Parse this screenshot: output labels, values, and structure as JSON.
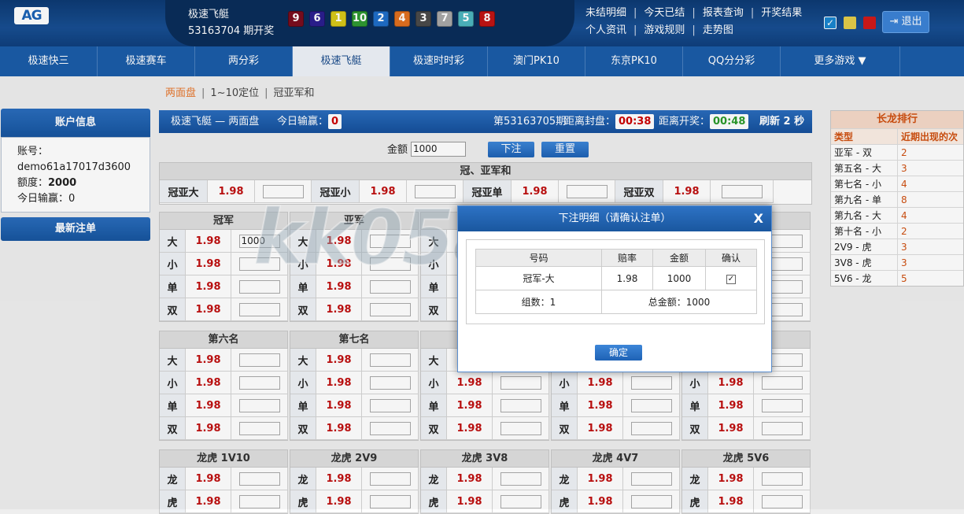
{
  "header": {
    "logo": "AG",
    "game_name": "极速飞艇",
    "period_open": "53163704 期开奖",
    "balls": [
      {
        "n": "9",
        "color": "#7a0d1f"
      },
      {
        "n": "6",
        "color": "#2b1f8f"
      },
      {
        "n": "1",
        "color": "#d8c81a"
      },
      {
        "n": "10",
        "color": "#2f9a32"
      },
      {
        "n": "2",
        "color": "#1f6ec8"
      },
      {
        "n": "4",
        "color": "#e07020"
      },
      {
        "n": "3",
        "color": "#4a4a4a"
      },
      {
        "n": "7",
        "color": "#a8a8a8"
      },
      {
        "n": "5",
        "color": "#4cb6bf"
      },
      {
        "n": "8",
        "color": "#c01414"
      }
    ],
    "links_row1": [
      "未结明细",
      "今天已结",
      "报表查询",
      "开奖结果"
    ],
    "links_row2": [
      "个人资讯",
      "游戏规则",
      "走势图"
    ],
    "logout": "退出"
  },
  "nav": [
    "极速快三",
    "极速赛车",
    "两分彩",
    "极速飞艇",
    "极速时时彩",
    "澳门PK10",
    "东京PK10",
    "QQ分分彩",
    "更多游戏 ▼"
  ],
  "subnav": {
    "items": [
      "两面盘",
      "1~10定位",
      "冠亚军和"
    ],
    "active": "两面盘"
  },
  "account": {
    "title": "账户信息",
    "acct_label": "账号：",
    "acct_value": "demo61a17017d3600",
    "quota_label": "额度：",
    "quota_value": "2000",
    "today_label": "今日输赢：",
    "today_value": "0",
    "latest_orders": "最新注单"
  },
  "infobar": {
    "title": "极速飞艇 — 两面盘",
    "today_label": "今日输赢：",
    "today_value": "0",
    "period": "第53163705期",
    "close_label": "距离封盘：",
    "close_value": "00:38",
    "open_label": "距离开奖：",
    "open_value": "00:48",
    "refresh": "刷新 2 秒"
  },
  "betbar": {
    "amount_label": "金额",
    "amount_value": "1000",
    "submit": "下注",
    "reset": "重置"
  },
  "gyh": {
    "title": "冠、亚军和",
    "items": [
      {
        "label": "冠亚大",
        "odds": "1.98"
      },
      {
        "label": "冠亚小",
        "odds": "1.98"
      },
      {
        "label": "冠亚单",
        "odds": "1.98"
      },
      {
        "label": "冠亚双",
        "odds": "1.98"
      }
    ]
  },
  "sections_row1": [
    {
      "title": "冠军",
      "rows": [
        {
          "label": "大",
          "odds": "1.98",
          "value": "1000"
        },
        {
          "label": "小",
          "odds": "1.98",
          "value": ""
        },
        {
          "label": "单",
          "odds": "1.98",
          "value": ""
        },
        {
          "label": "双",
          "odds": "1.98",
          "value": ""
        }
      ]
    },
    {
      "title": "亚军",
      "rows": [
        {
          "label": "大",
          "odds": "1.98",
          "value": ""
        },
        {
          "label": "小",
          "odds": "1.98",
          "value": ""
        },
        {
          "label": "单",
          "odds": "1.98",
          "value": ""
        },
        {
          "label": "双",
          "odds": "1.98",
          "value": ""
        }
      ]
    },
    {
      "title": "",
      "rows": [
        {
          "label": "大",
          "odds": "",
          "value": ""
        },
        {
          "label": "小",
          "odds": "",
          "value": ""
        },
        {
          "label": "单",
          "odds": "",
          "value": ""
        },
        {
          "label": "双",
          "odds": "",
          "value": ""
        }
      ]
    },
    {
      "title": "",
      "rows": [
        {
          "label": "",
          "odds": "",
          "value": ""
        },
        {
          "label": "",
          "odds": "",
          "value": ""
        },
        {
          "label": "",
          "odds": "",
          "value": ""
        },
        {
          "label": "",
          "odds": "",
          "value": ""
        }
      ]
    },
    {
      "title": "",
      "rows": [
        {
          "label": "",
          "odds": "",
          "value": ""
        },
        {
          "label": "",
          "odds": "",
          "value": ""
        },
        {
          "label": "",
          "odds": "",
          "value": ""
        },
        {
          "label": "",
          "odds": "",
          "value": ""
        }
      ]
    }
  ],
  "sections_row2": [
    {
      "title": "第六名",
      "rows": [
        {
          "label": "大",
          "odds": "1.98"
        },
        {
          "label": "小",
          "odds": "1.98"
        },
        {
          "label": "单",
          "odds": "1.98"
        },
        {
          "label": "双",
          "odds": "1.98"
        }
      ]
    },
    {
      "title": "第七名",
      "rows": [
        {
          "label": "大",
          "odds": "1.98"
        },
        {
          "label": "小",
          "odds": "1.98"
        },
        {
          "label": "单",
          "odds": "1.98"
        },
        {
          "label": "双",
          "odds": "1.98"
        }
      ]
    },
    {
      "title": "",
      "rows": [
        {
          "label": "大",
          "odds": ""
        },
        {
          "label": "小",
          "odds": "1.98"
        },
        {
          "label": "单",
          "odds": "1.98"
        },
        {
          "label": "双",
          "odds": "1.98"
        }
      ]
    },
    {
      "title": "",
      "rows": [
        {
          "label": "",
          "odds": ""
        },
        {
          "label": "小",
          "odds": "1.98"
        },
        {
          "label": "单",
          "odds": "1.98"
        },
        {
          "label": "双",
          "odds": "1.98"
        }
      ]
    },
    {
      "title": "",
      "rows": [
        {
          "label": "",
          "odds": ""
        },
        {
          "label": "小",
          "odds": "1.98"
        },
        {
          "label": "单",
          "odds": "1.98"
        },
        {
          "label": "双",
          "odds": "1.98"
        }
      ]
    }
  ],
  "sections_row3": [
    {
      "title": "龙虎 1V10",
      "rows": [
        {
          "label": "龙",
          "odds": "1.98"
        },
        {
          "label": "虎",
          "odds": "1.98"
        }
      ]
    },
    {
      "title": "龙虎 2V9",
      "rows": [
        {
          "label": "龙",
          "odds": "1.98"
        },
        {
          "label": "虎",
          "odds": "1.98"
        }
      ]
    },
    {
      "title": "龙虎 3V8",
      "rows": [
        {
          "label": "龙",
          "odds": "1.98"
        },
        {
          "label": "虎",
          "odds": "1.98"
        }
      ]
    },
    {
      "title": "龙虎 4V7",
      "rows": [
        {
          "label": "龙",
          "odds": "1.98"
        },
        {
          "label": "虎",
          "odds": "1.98"
        }
      ]
    },
    {
      "title": "龙虎 5V6",
      "rows": [
        {
          "label": "龙",
          "odds": "1.98"
        },
        {
          "label": "虎",
          "odds": "1.98"
        }
      ]
    }
  ],
  "ranking": {
    "title": "长龙排行",
    "col_type": "类型",
    "col_recent": "近期出现的次",
    "rows": [
      {
        "type": "亚军 - 双",
        "count": "2"
      },
      {
        "type": "第五名 - 大",
        "count": "3"
      },
      {
        "type": "第七名 - 小",
        "count": "4"
      },
      {
        "type": "第九名 - 单",
        "count": "8"
      },
      {
        "type": "第九名 - 大",
        "count": "4"
      },
      {
        "type": "第十名 - 小",
        "count": "2"
      },
      {
        "type": "2V9 - 虎",
        "count": "3"
      },
      {
        "type": "3V8 - 虎",
        "count": "3"
      },
      {
        "type": "5V6 - 龙",
        "count": "5"
      }
    ]
  },
  "modal": {
    "title": "下注明细（请确认注单）",
    "close": "X",
    "col_code": "号码",
    "col_odds": "赔率",
    "col_amount": "金额",
    "col_confirm": "确认",
    "row_code": "冠军-大",
    "row_odds": "1.98",
    "row_amount": "1000",
    "groups": "组数：1",
    "total": "总金额：1000",
    "confirm_btn": "确定"
  },
  "watermark": "kk058.com"
}
